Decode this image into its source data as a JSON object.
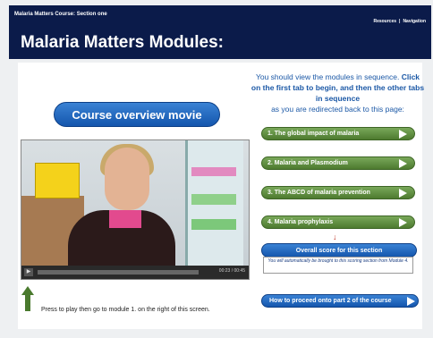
{
  "header": {
    "course_title": "Malaria Matters Course: Section one",
    "resources": "Resources",
    "separator": "|",
    "navigation": "Navigation",
    "page_title": "Malaria Matters Modules:"
  },
  "intro": {
    "line_a": "You should view the modules in sequence.",
    "line_b": "Click on the first tab to begin, and then the other tabs in sequence",
    "line_c": "as you are redirected back to this page:"
  },
  "overview_button": "Course overview movie",
  "video": {
    "play_symbol": "▶",
    "time": "00:23 / 00:45",
    "progress": 0.0
  },
  "press_text": "Press to play then go to module 1. on the right of this screen.",
  "modules": [
    "1. The global impact of malaria",
    "2. Malaria and Plasmodium",
    "3. The ABCD of malaria prevention",
    "4. Malaria prophylaxis"
  ],
  "down_arrow": "↓",
  "score_button": "Overall score for this section",
  "score_note": "You will automatically be brought to this scoring section from Module 4.",
  "proceed_button": "How to proceed onto part 2 of the course",
  "colors": {
    "header_bg": "#0b1b4a",
    "module_green": "#4d7a2f",
    "button_blue": "#1456ad",
    "intro_text": "#1b58a6"
  },
  "icons": {
    "module_arrow": "play-triangle-icon",
    "up_arrow": "up-arrow-icon"
  }
}
